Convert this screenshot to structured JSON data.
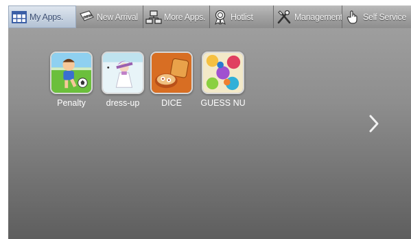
{
  "tabs": [
    {
      "label": "My Apps.",
      "icon": "apps-grid-icon",
      "selected": true
    },
    {
      "label": "New Arrival",
      "icon": "new-tag-icon",
      "selected": false
    },
    {
      "label": "More Apps.",
      "icon": "network-icon",
      "selected": false
    },
    {
      "label": "Hotlist",
      "icon": "award-ribbon-icon",
      "selected": false
    },
    {
      "label": "Management",
      "icon": "tools-icon",
      "selected": false
    },
    {
      "label": "Self Service",
      "icon": "hand-pointer-icon",
      "selected": false
    }
  ],
  "apps": [
    {
      "label": "Penalty",
      "icon": "penalty-game-icon"
    },
    {
      "label": "dress-up",
      "icon": "dress-up-game-icon"
    },
    {
      "label": "DICE",
      "icon": "dice-game-icon"
    },
    {
      "label": "GUESS NU",
      "icon": "guess-number-game-icon"
    }
  ],
  "icon_tag_text": "new",
  "colors": {
    "tab_selected_text": "#3b4e72",
    "content_bg": "#8e8e8e"
  }
}
